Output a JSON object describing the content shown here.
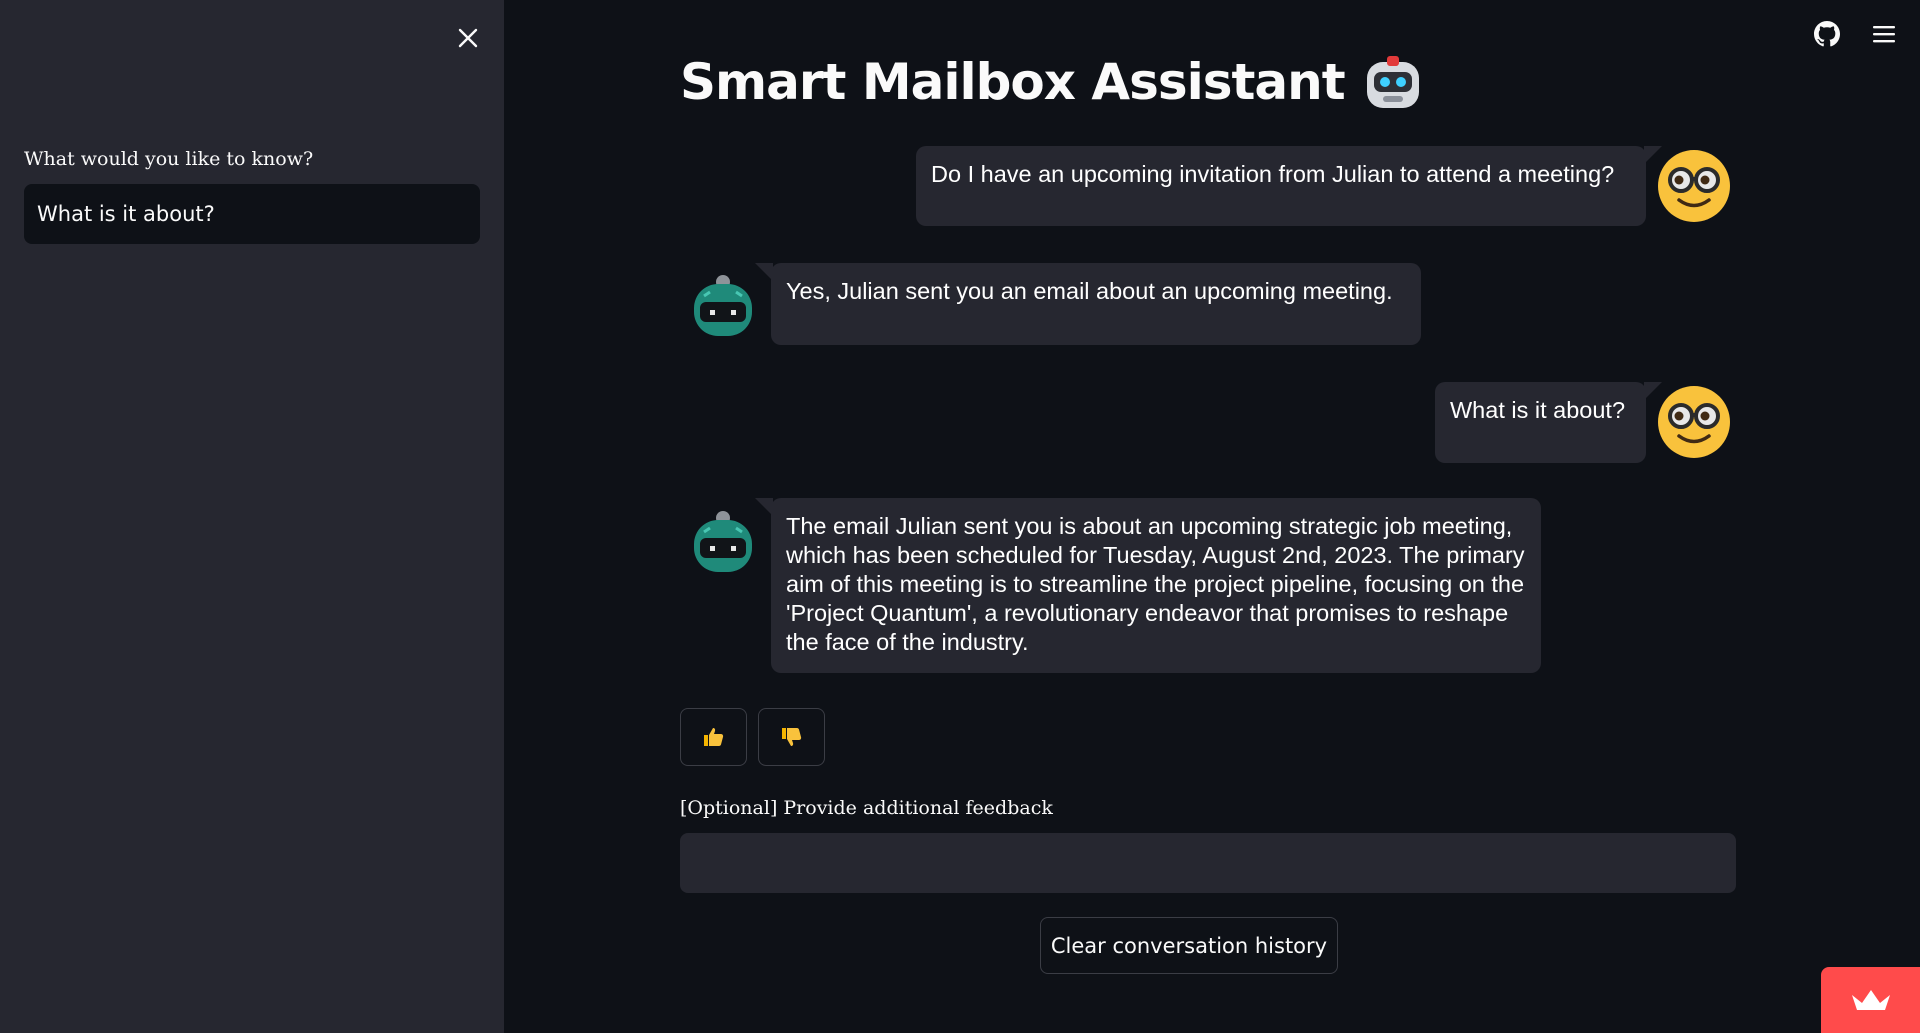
{
  "colors": {
    "background": "#0e1117",
    "sidebar": "#262730",
    "bubble": "#262730",
    "accent": "#ff4b4b",
    "user_avatar": "#f9c23c",
    "bot_avatar": "#1f8a7a"
  },
  "sidebar": {
    "close_icon": "close-icon",
    "label": "What would you like to know?",
    "input_value": "What is it about?"
  },
  "header": {
    "github_icon": "github-icon",
    "menu_icon": "hamburger-menu-icon"
  },
  "main": {
    "title": "Smart Mailbox Assistant",
    "title_emoji": "robot-emoji",
    "messages": [
      {
        "role": "user",
        "text": "Do I have an upcoming invitation from Julian to attend a meeting?",
        "avatar": "nerd-face-emoji"
      },
      {
        "role": "assistant",
        "text": "Yes, Julian sent you an email about an upcoming meeting.",
        "avatar": "robot-avatar"
      },
      {
        "role": "user",
        "text": "What is it about?",
        "avatar": "nerd-face-emoji"
      },
      {
        "role": "assistant",
        "text": "The email Julian sent you is about an upcoming strategic job meeting, which has been scheduled for Tuesday, August 2nd, 2023. The primary aim of this meeting is to streamline the project pipeline, focusing on the 'Project Quantum', a revolutionary endeavor that promises to reshape the face of the industry.",
        "avatar": "robot-avatar"
      }
    ],
    "feedback": {
      "thumbs_up_icon": "thumbs-up-icon",
      "thumbs_down_icon": "thumbs-down-icon",
      "label": "[Optional] Provide additional feedback",
      "input_value": ""
    },
    "clear_button": "Clear conversation history",
    "badge_icon": "streamlit-crown-icon"
  }
}
